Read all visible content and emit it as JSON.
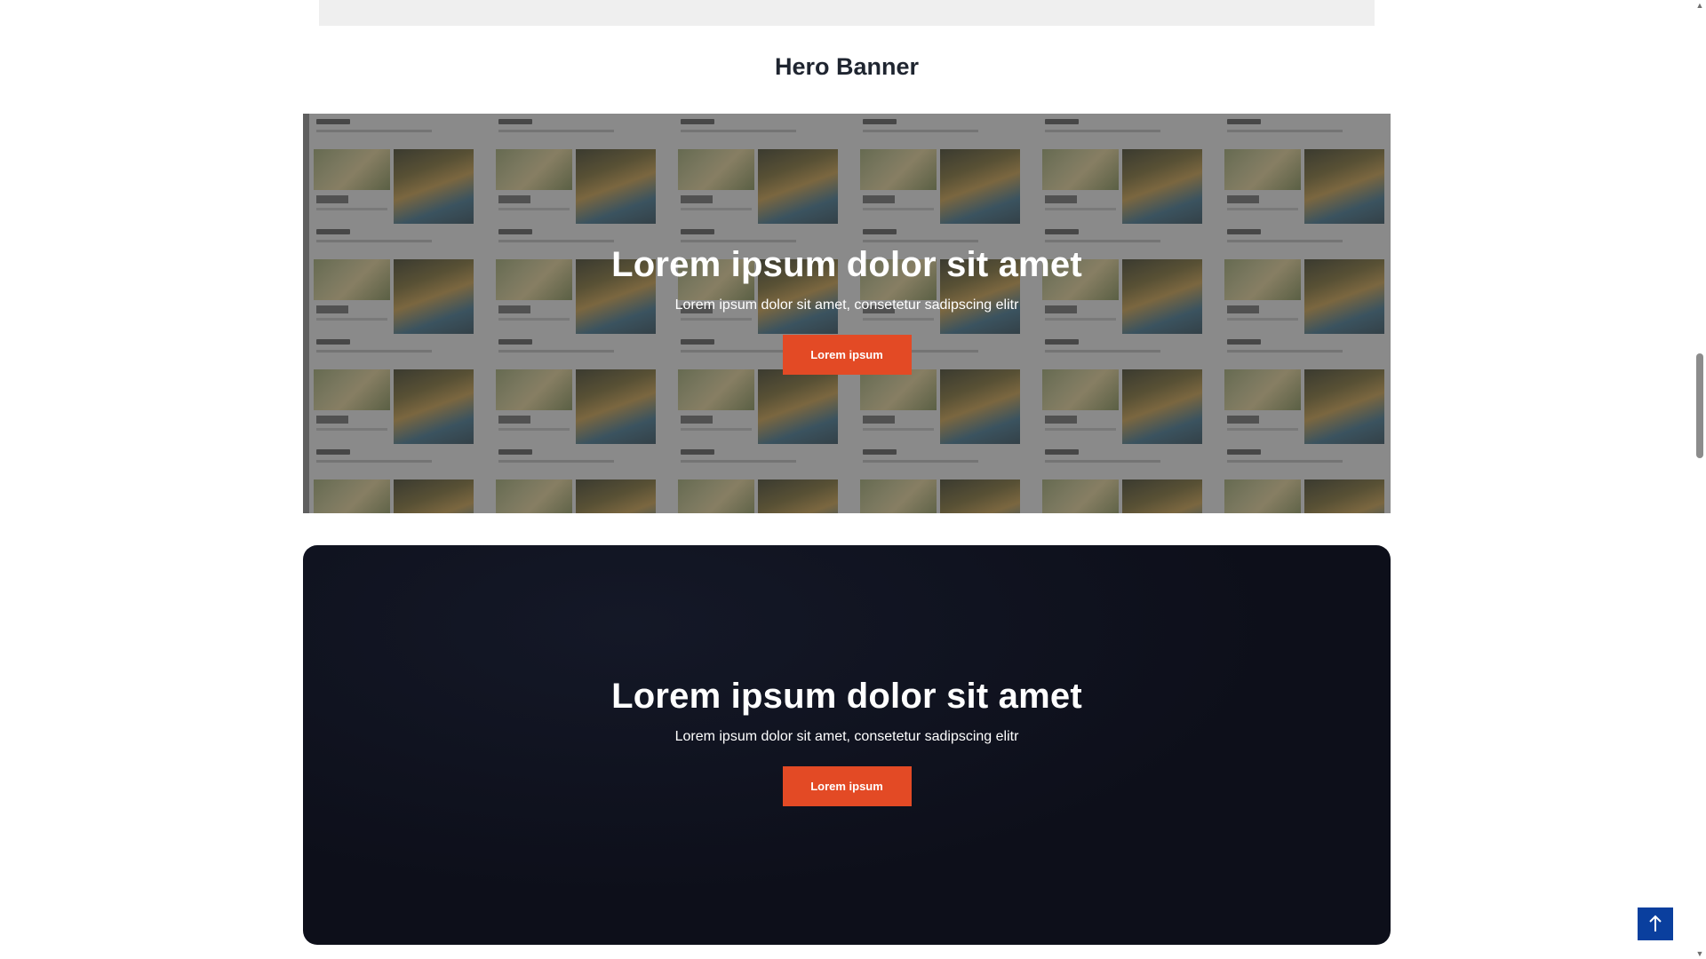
{
  "section": {
    "title": "Hero Banner"
  },
  "hero_image_banner": {
    "heading": "Lorem ipsum dolor sit amet",
    "subheading": "Lorem ipsum dolor sit amet, consetetur sadipscing elitr",
    "button_label": "Lorem ipsum",
    "button_color": "#e34a25",
    "overlay_color": "#8a8a8a"
  },
  "hero_dark_banner": {
    "heading": "Lorem ipsum dolor sit amet",
    "subheading": "Lorem ipsum dolor sit amet, consetetur sadipscing elitr",
    "button_label": "Lorem ipsum",
    "button_color": "#e34a25",
    "background_color": "#0e101b"
  },
  "back_to_top": {
    "icon": "arrow-up-icon",
    "color": "#0a3f9e"
  },
  "scrollbar": {
    "up_icon": "scroll-up-icon",
    "down_icon": "scroll-down-icon"
  }
}
